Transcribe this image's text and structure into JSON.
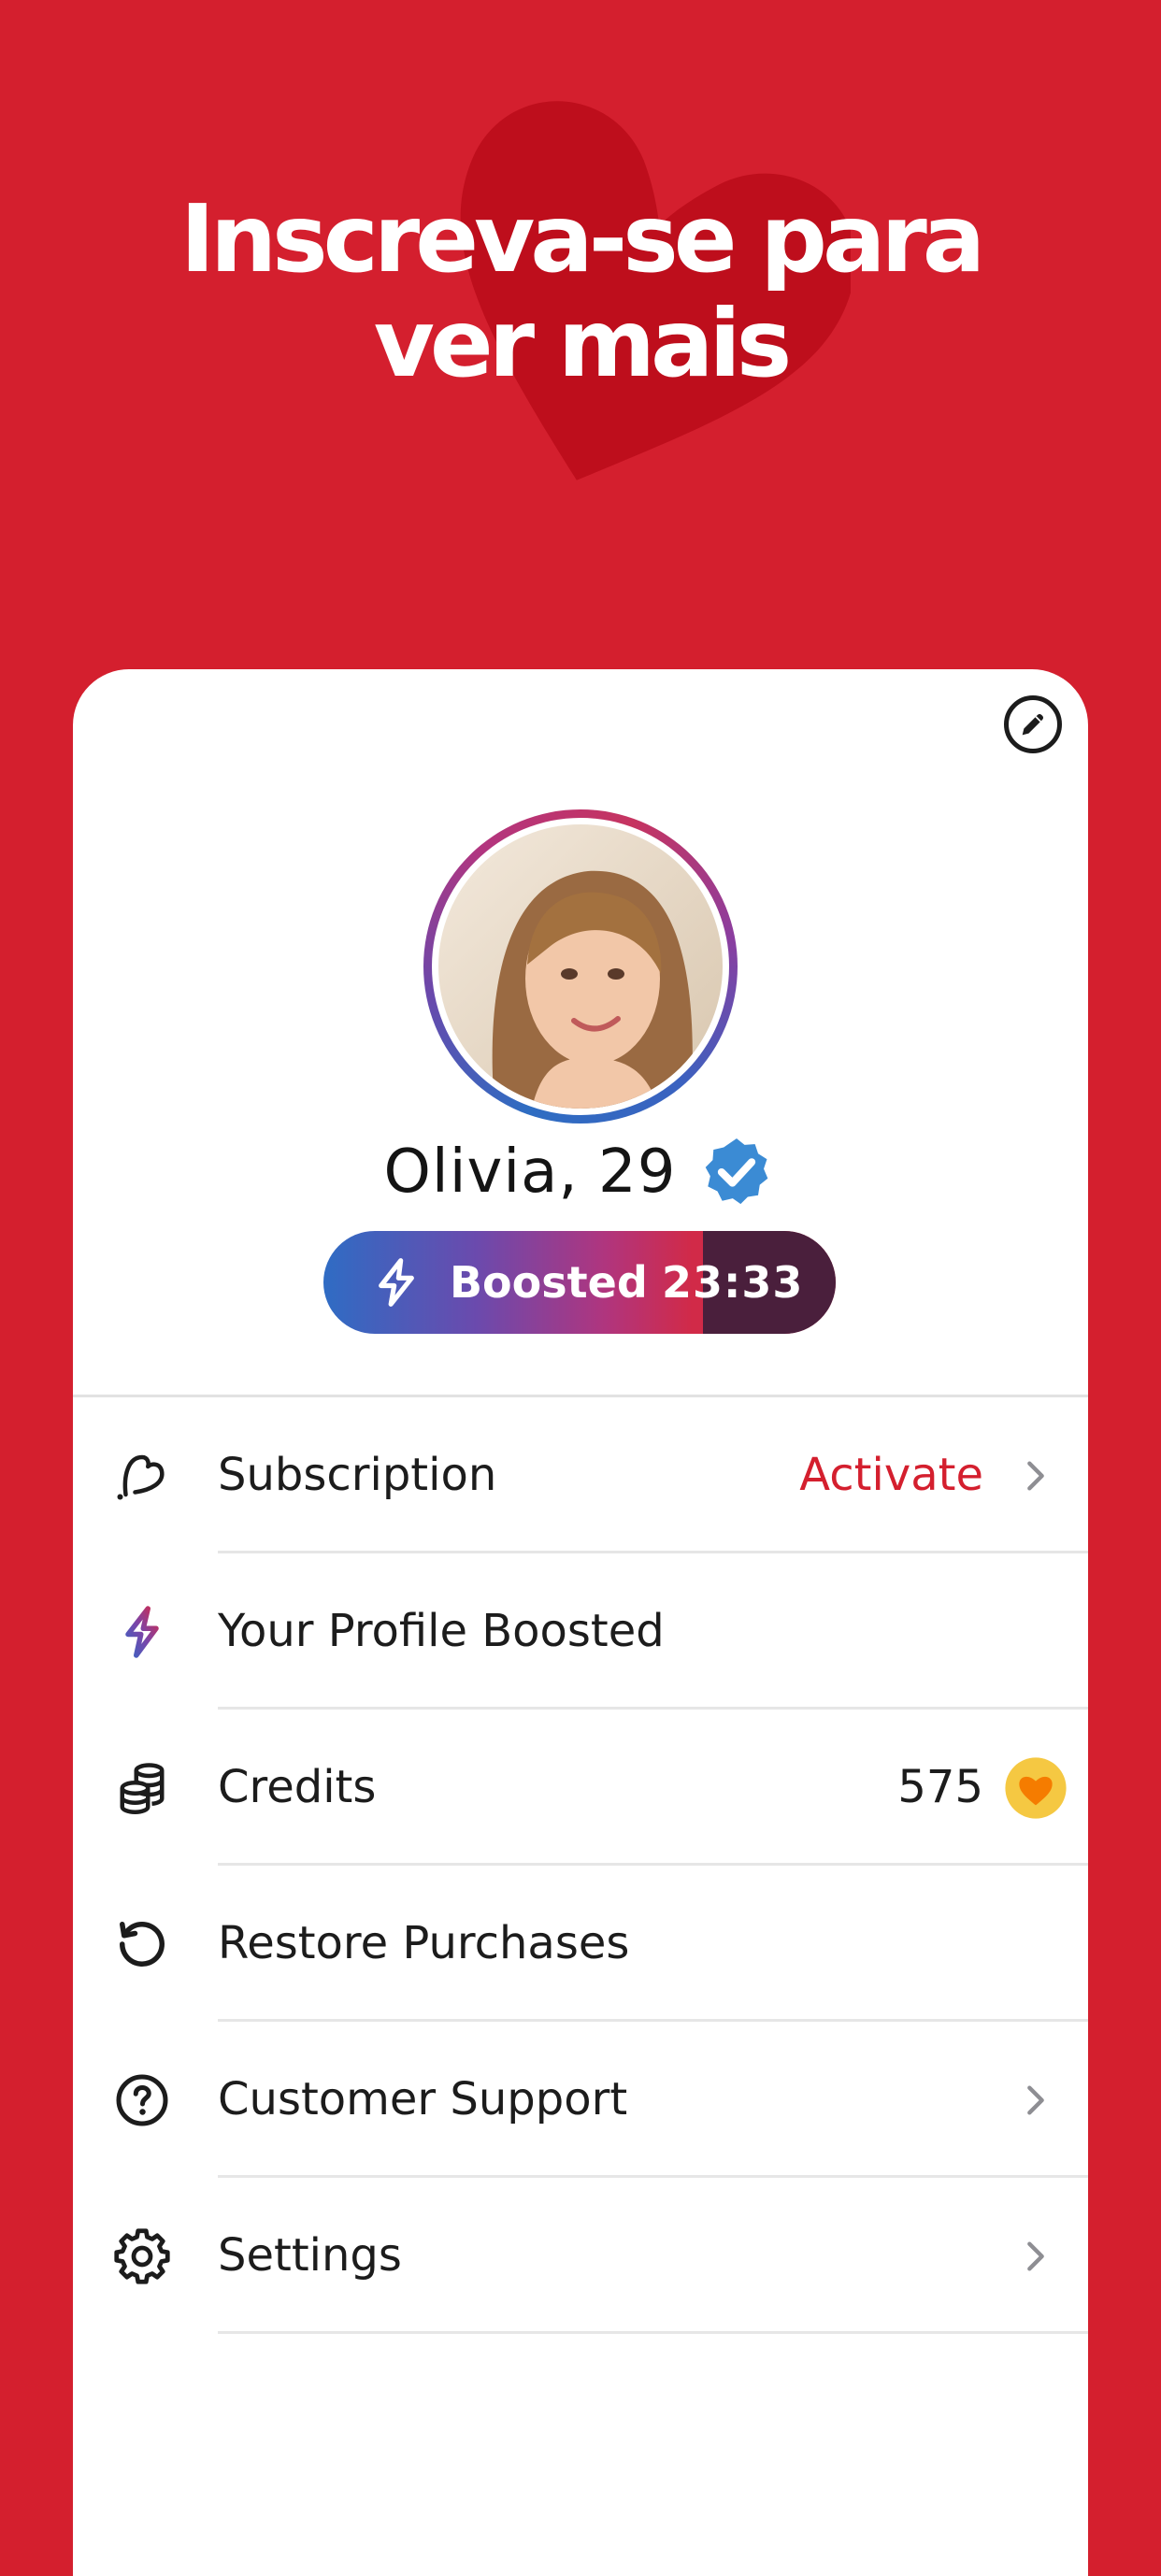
{
  "colors": {
    "background": "#d41f2e",
    "accent": "#d41f2e",
    "coin": "#f5c842"
  },
  "header": {
    "line1": "Inscreva-se para",
    "line2": "ver mais"
  },
  "profile": {
    "name_age": "Olivia, 29",
    "verified_icon": "verified-badge-icon",
    "edit_icon": "pencil-icon",
    "boost": {
      "label": "Boosted",
      "timer": "23:33",
      "icon": "lightning-icon"
    }
  },
  "menu": {
    "subscription": {
      "label": "Subscription",
      "value": "Activate",
      "icon": "heart-outline-icon"
    },
    "boosted": {
      "label": "Your Profile Boosted",
      "icon": "lightning-icon"
    },
    "credits": {
      "label": "Credits",
      "value": "575",
      "icon": "coins-icon",
      "badge_icon": "heart-coin-icon"
    },
    "restore": {
      "label": "Restore Purchases",
      "icon": "restore-icon"
    },
    "support": {
      "label": "Customer Support",
      "icon": "help-circle-icon"
    },
    "settings": {
      "label": "Settings",
      "icon": "gear-icon"
    }
  }
}
